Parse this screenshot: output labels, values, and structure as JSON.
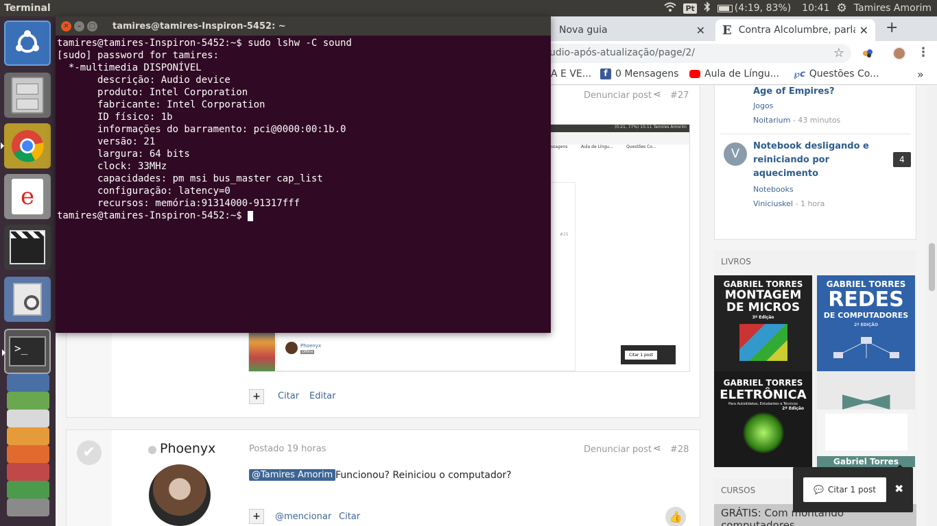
{
  "topbar": {
    "app_name": "Terminal",
    "lang": "Pt",
    "battery": "(4:19, 83%)",
    "battery_level": 0.83,
    "time": "10:41",
    "user": "Tamires Amorim"
  },
  "launcher": {
    "icons": [
      "ubuntu-dash-icon",
      "file-cabinet-icon",
      "chrome-icon",
      "text-editor-icon",
      "video-editor-icon",
      "image-viewer-icon",
      "terminal-icon"
    ]
  },
  "browser": {
    "tabs": [
      {
        "label": "Nova guia"
      },
      {
        "label": "Contra Alcolumbre, parla",
        "favicon": "E"
      }
    ],
    "url": "udio-após-atualização/page/2/",
    "bookmarks": [
      {
        "label": "A E VE..."
      },
      {
        "label": "0 Mensagens"
      },
      {
        "label": "Aula de Língu..."
      },
      {
        "label": "Questões Co..."
      }
    ],
    "more": "»"
  },
  "post27": {
    "report": "Denunciar post",
    "num": "#27",
    "cite": "Citar",
    "edit": "Editar",
    "plus": "+"
  },
  "post28": {
    "author": "Phoenyx",
    "posted": "Postado 19 horas",
    "report": "Denunciar post",
    "num": "#28",
    "mention_tag": "@Tamires Amorim",
    "body": "Funcionou? Reiniciou o computador?",
    "mention": "@mencionar",
    "cite": "Citar",
    "plus": "+"
  },
  "embedded": {
    "topbar": "(0:21, 77%)  15:11  Tamires Amorim",
    "bm1": "ssagens",
    "bm2": "Aula de Língu...",
    "bm3": "Questões Co...",
    "num": "#25",
    "author": "Phoenyx",
    "status": "Offline",
    "quote": "Citar 1 post"
  },
  "sidebar": {
    "items": [
      {
        "title": "Age of Empires?",
        "cat": "Jogos",
        "user": "Noitarium",
        "time": " - 43 minutos"
      },
      {
        "title": "Notebook desligando e reiniciando por aquecimento",
        "cat": "Notebooks",
        "user": "Viniciuskel",
        "time": " - 1 hora",
        "avatar": "V",
        "count": "4"
      }
    ],
    "books_title": "LIVROS",
    "books": [
      {
        "l1": "GABRIEL TORRES",
        "l2": "MONTAGEM",
        "l3": "DE MICROS",
        "l4": "3ª Edição"
      },
      {
        "l1": "GABRIEL TORRES",
        "l2": "REDES",
        "l3": "DE COMPUTADORES",
        "l4": "2ª EDIÇÃO"
      },
      {
        "l1": "GABRIEL TORRES",
        "l2": "ELETRÔNICA",
        "l3": "Para Autodidatas, Estudantes e Técnicos",
        "l4": "2ª Edição"
      },
      {
        "l1": "Gabriel Torres",
        "l2": "",
        "l3": "",
        "l4": ""
      }
    ],
    "courses_title": "CURSOS",
    "course": "GRÁTIS: Com montando computadores"
  },
  "popup": {
    "quote": "Citar 1 post",
    "close": "✖"
  },
  "terminal": {
    "title": "tamires@tamires-Inspiron-5452: ~",
    "lines": [
      "tamires@tamires-Inspiron-5452:~$ sudo lshw -C sound",
      "[sudo] password for tamires: ",
      "  *-multimedia DISPONÍVEL",
      "       descrição: Audio device",
      "       produto: Intel Corporation",
      "       fabricante: Intel Corporation",
      "       ID físico: 1b",
      "       informações do barramento: pci@0000:00:1b.0",
      "       versão: 21",
      "       largura: 64 bits",
      "       clock: 33MHz",
      "       capacidades: pm msi bus_master cap_list",
      "       configuração: latency=0",
      "       recursos: memória:91314000-91317fff"
    ],
    "prompt": "tamires@tamires-Inspiron-5452:~$ "
  }
}
